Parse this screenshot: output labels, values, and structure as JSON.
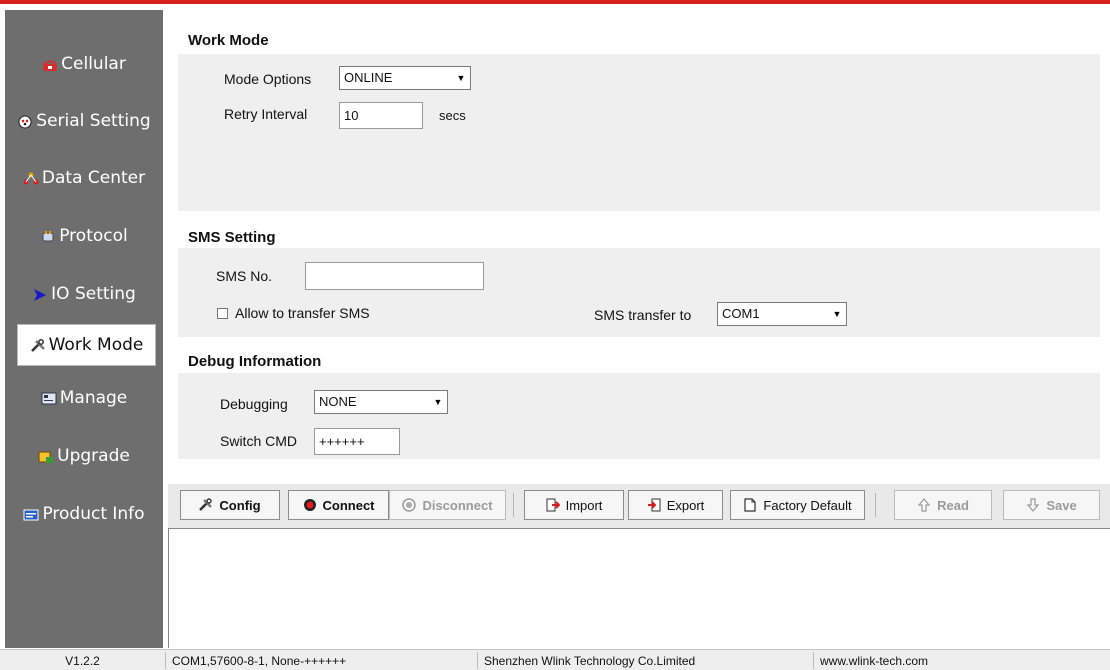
{
  "sidebar": {
    "items": [
      {
        "label": "Cellular",
        "icon": "phone-icon"
      },
      {
        "label": "Serial Setting",
        "icon": "serial-port-icon"
      },
      {
        "label": "Data Center",
        "icon": "network-icon"
      },
      {
        "label": "Protocol",
        "icon": "plug-icon"
      },
      {
        "label": "IO Setting",
        "icon": "arrow-right-icon"
      },
      {
        "label": "Work Mode",
        "icon": "tools-icon"
      },
      {
        "label": "Manage",
        "icon": "console-icon"
      },
      {
        "label": "Upgrade",
        "icon": "upgrade-icon"
      },
      {
        "label": "Product Info",
        "icon": "info-board-icon"
      }
    ],
    "active": "Work Mode"
  },
  "work_mode": {
    "title": "Work Mode",
    "mode_options_label": "Mode Options",
    "mode_options_value": "ONLINE",
    "retry_interval_label": "Retry Interval",
    "retry_interval_value": "10",
    "retry_interval_unit": "secs"
  },
  "sms": {
    "title": "SMS Setting",
    "sms_no_label": "SMS No.",
    "sms_no_value": "",
    "allow_transfer_label": "Allow to transfer SMS",
    "allow_transfer_checked": false,
    "transfer_to_label": "SMS transfer to",
    "transfer_to_value": "COM1"
  },
  "debug": {
    "title": "Debug Information",
    "debugging_label": "Debugging",
    "debugging_value": "NONE",
    "switch_cmd_label": "Switch CMD",
    "switch_cmd_value": "++++++"
  },
  "toolbar": {
    "config": "Config",
    "connect": "Connect",
    "disconnect": "Disconnect",
    "import": "Import",
    "export": "Export",
    "factory_default": "Factory Default",
    "read": "Read",
    "save": "Save"
  },
  "statusbar": {
    "version": "V1.2.2",
    "port": "COM1,57600-8-1, None-++++++",
    "company": "Shenzhen Wlink Technology Co.Limited",
    "website": "www.wlink-tech.com"
  },
  "colors": {
    "accent": "#d61e1e",
    "sidebar_bg": "#6e6e6e",
    "panel_bg": "#efefef"
  }
}
